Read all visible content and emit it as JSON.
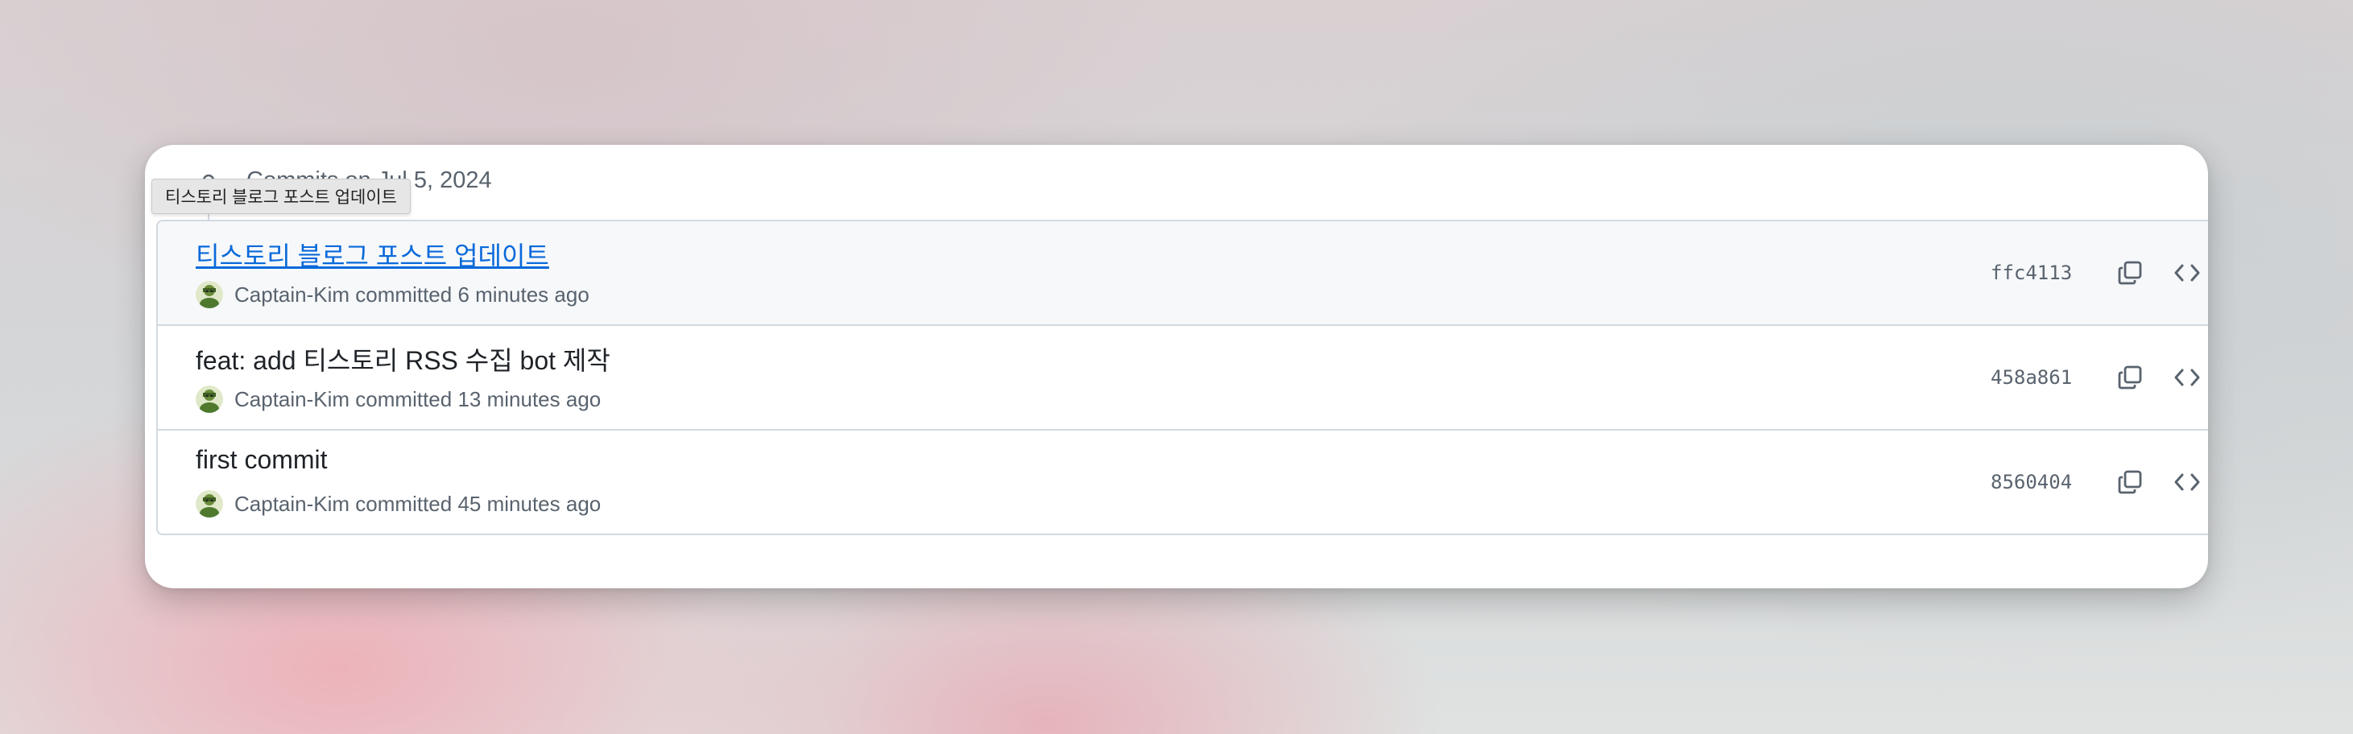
{
  "history": {
    "date_header": "Commits on Jul 5, 2024",
    "tooltip": "티스토리 블로그 포스트 업데이트",
    "commits": [
      {
        "message": "티스토리 블로그 포스트 업데이트",
        "author": "Captain-Kim",
        "action": "committed",
        "time": "6 minutes ago",
        "sha": "ffc4113"
      },
      {
        "message": "feat: add 티스토리 RSS 수집 bot 제작",
        "author": "Captain-Kim",
        "action": "committed",
        "time": "13 minutes ago",
        "sha": "458a861"
      },
      {
        "message": "first commit",
        "author": "Captain-Kim",
        "action": "committed",
        "time": "45 minutes ago",
        "sha": "8560404"
      }
    ]
  },
  "icons": {
    "commit": "git-commit-icon",
    "avatar": "user-avatar",
    "copy": "copy-icon",
    "browse": "code-brackets-icon"
  },
  "colors": {
    "link": "#0969da",
    "muted": "#59636e",
    "border": "#d1d9e0",
    "highlight_row": "#f6f8fa"
  }
}
